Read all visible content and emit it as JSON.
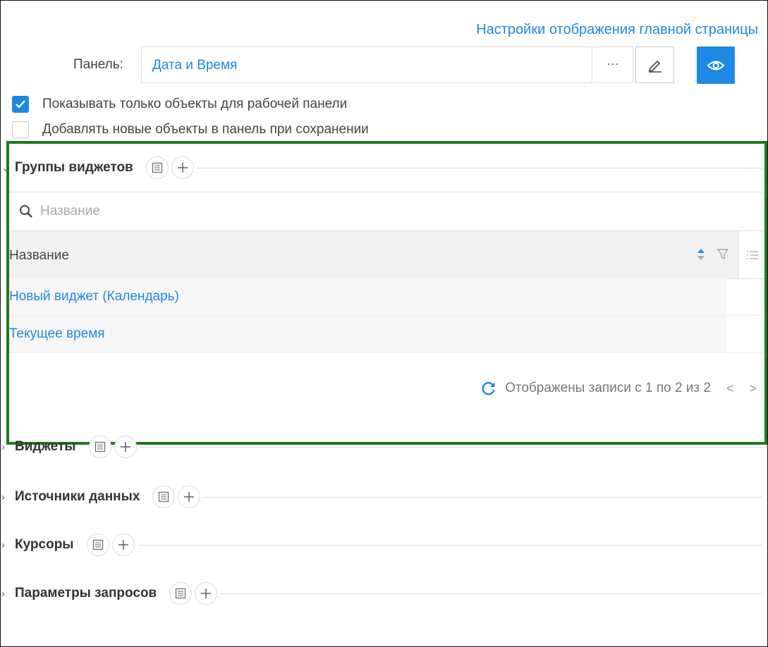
{
  "header": {
    "settings_link": "Настройки отображения главной страницы"
  },
  "panel": {
    "label": "Панель:",
    "value": "Дата и Время",
    "dots": "···"
  },
  "options": {
    "show_only": "Показывать только объекты для рабочей панели",
    "show_only_checked": true,
    "add_new": "Добавлять новые объекты в панель при сохранении",
    "add_new_checked": false
  },
  "widget_groups": {
    "title": "Группы виджетов",
    "search_placeholder": "Название",
    "column": "Название",
    "rows": [
      "Новый виджет (Календарь)",
      "Текущее время"
    ],
    "pager": "Отображены записи с 1 по 2 из 2"
  },
  "sections": [
    {
      "title": "Виджеты"
    },
    {
      "title": "Источники данных"
    },
    {
      "title": "Курсоры"
    },
    {
      "title": "Параметры запросов"
    }
  ],
  "colors": {
    "accent": "#1e88e5",
    "highlight": "#1e7a1e"
  }
}
